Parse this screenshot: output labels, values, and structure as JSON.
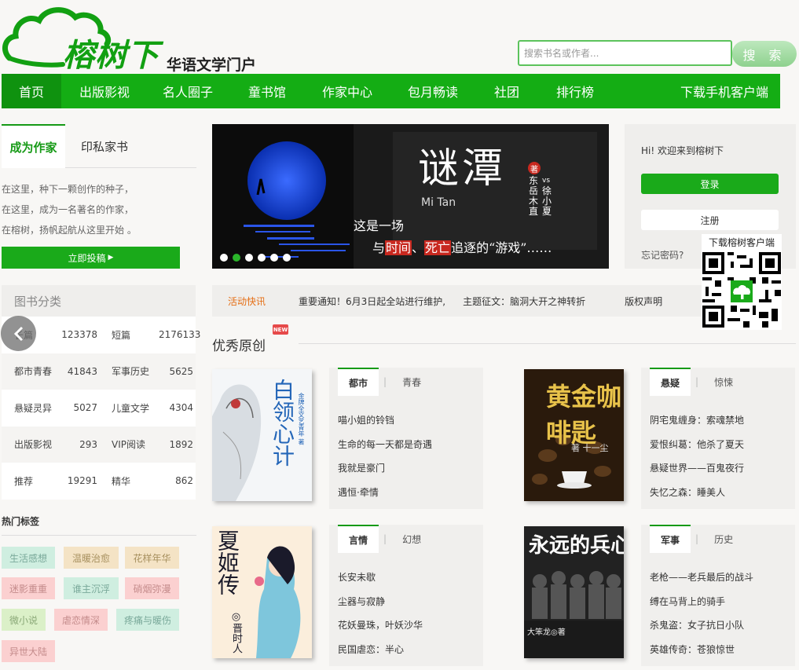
{
  "header": {
    "logo_text": "榕树下",
    "logo_sub": "华语文学门户",
    "search_placeholder": "搜索书名或作者...",
    "search_button": "搜 索"
  },
  "nav": [
    "首页",
    "出版影视",
    "名人圈子",
    "童书馆",
    "作家中心",
    "包月畅读",
    "社团",
    "排行榜",
    "下载手机客户端"
  ],
  "left": {
    "tab_writer": "成为作家",
    "tab_print": "印私家书",
    "intro": [
      "在这里，种下一颗创作的种子，",
      "在这里，成为一名著名的作家，",
      "在榕树，扬帆起航从这里开始 。"
    ],
    "submit_button": "立即投稿",
    "category_title": "图书分类",
    "categories": [
      [
        "长篇",
        "123378",
        "短篇",
        "2176133"
      ],
      [
        "都市青春",
        "41843",
        "军事历史",
        "5625"
      ],
      [
        "悬疑灵异",
        "5027",
        "儿童文学",
        "4304"
      ],
      [
        "出版影视",
        "293",
        "VIP阅读",
        "1892"
      ],
      [
        "推荐",
        "19291",
        "精华",
        "862"
      ]
    ],
    "hot_tags_title": "热门标签",
    "hot_tags": [
      "生活感想",
      "温暖治愈",
      "花样年华",
      "迷影重重",
      "谁主沉浮",
      "硝烟弥漫",
      "微小说",
      "虐恋情深",
      "疼痛与暖伤",
      "异世大陆"
    ]
  },
  "banner": {
    "title": "谜潭",
    "pinyin": "Mi Tan",
    "seal": "著",
    "authors": [
      "东",
      "vs",
      "岳",
      "徐",
      "木",
      "小",
      "直",
      "夏"
    ],
    "line1": "这是一场",
    "line2_pre": "与",
    "line2_a": "时间",
    "line2_sep": "、",
    "line2_b": "死亡",
    "line2_post": "追逐的“游戏”……"
  },
  "login": {
    "welcome": "Hi! 欢迎来到榕树下",
    "login_button": "登录",
    "register_button": "注册",
    "forgot": "忘记密码?",
    "qr_title": "下载榕树客户端"
  },
  "news": {
    "label": "活动快讯",
    "items": [
      "重要通知！6月3日起全站进行维护,",
      "主题征文：脑洞大开之神转折",
      "版权声明"
    ]
  },
  "section": {
    "title": "优秀原创",
    "badge": "NEW"
  },
  "books": [
    {
      "cover_title": "白领心计",
      "cover_sub": "金牌全文艺青年 著",
      "tabs": [
        "都市",
        "青春"
      ],
      "items": [
        "喵小姐的铃铛",
        "生命的每一天都是奇遇",
        "我就是豪门",
        "遇恒·牵情"
      ]
    },
    {
      "cover_title": "黄金咖啡匙",
      "cover_sub": "著 十一尘",
      "tabs": [
        "悬疑",
        "惊悚"
      ],
      "items": [
        "阴宅鬼缠身：索魂禁地",
        "爱恨纠葛：他杀了夏天",
        "悬疑世界——百鬼夜行",
        "失忆之森：睡美人"
      ]
    },
    {
      "cover_title": "夏姬传",
      "cover_sub": "◎晋时人",
      "tabs": [
        "言情",
        "幻想"
      ],
      "items": [
        "长安未歇",
        "尘器与寂静",
        "花妖曼珠，叶妖沙华",
        "民国虐恋：半心"
      ]
    },
    {
      "cover_title": "永远的兵心",
      "cover_sub": "大笨龙◎著",
      "tabs": [
        "军事",
        "历史"
      ],
      "items": [
        "老枪——老兵最后的战斗",
        "缚在马背上的骑手",
        "杀鬼盗：女子抗日小队",
        "英雄传奇：苍狼惊世"
      ]
    }
  ],
  "colors": {
    "brand_green": "#14ad14",
    "news_orange": "#e56f16"
  }
}
